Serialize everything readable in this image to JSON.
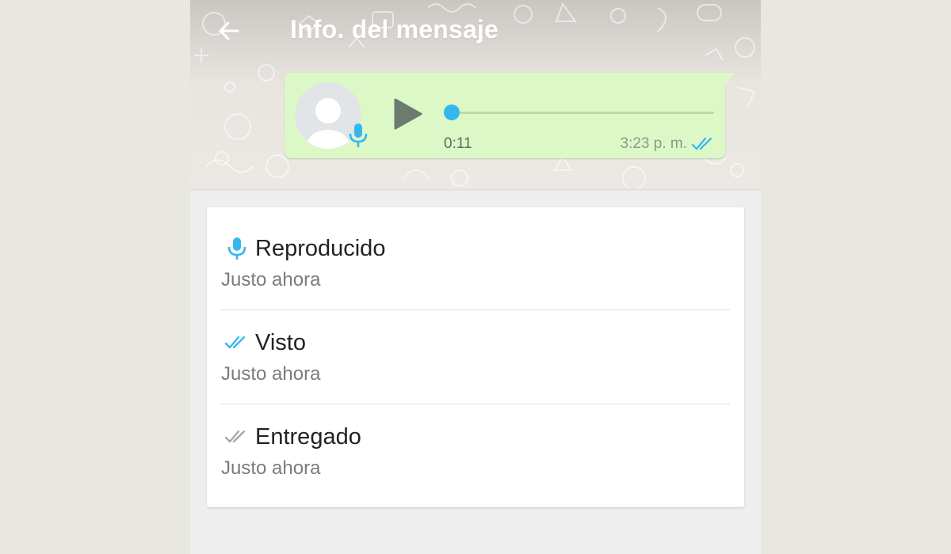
{
  "header": {
    "title": "Info. del mensaje",
    "back_icon": "arrow-left-icon"
  },
  "message": {
    "type": "voice-note",
    "duration": "0:11",
    "time": "3:23 p. m.",
    "playback_progress": 0,
    "status_icon": "double-check-icon",
    "avatar_icon": "default-avatar-icon",
    "mic_icon": "microphone-icon"
  },
  "receipts": [
    {
      "title": "Reproducido",
      "subtitle": "Justo ahora",
      "icon": "microphone-icon",
      "icon_color": "#34b7f1"
    },
    {
      "title": "Visto",
      "subtitle": "Justo ahora",
      "icon": "double-check-icon",
      "icon_color": "#34b7f1"
    },
    {
      "title": "Entregado",
      "subtitle": "Justo ahora",
      "icon": "double-check-icon",
      "icon_color": "#a8a8a8"
    }
  ],
  "colors": {
    "bubble": "#dcf8c6",
    "accent_blue": "#34b7f1",
    "play_button": "#6b7b70",
    "read_ticks": "#34b7f1",
    "delivered_ticks": "#a8a8a8"
  }
}
